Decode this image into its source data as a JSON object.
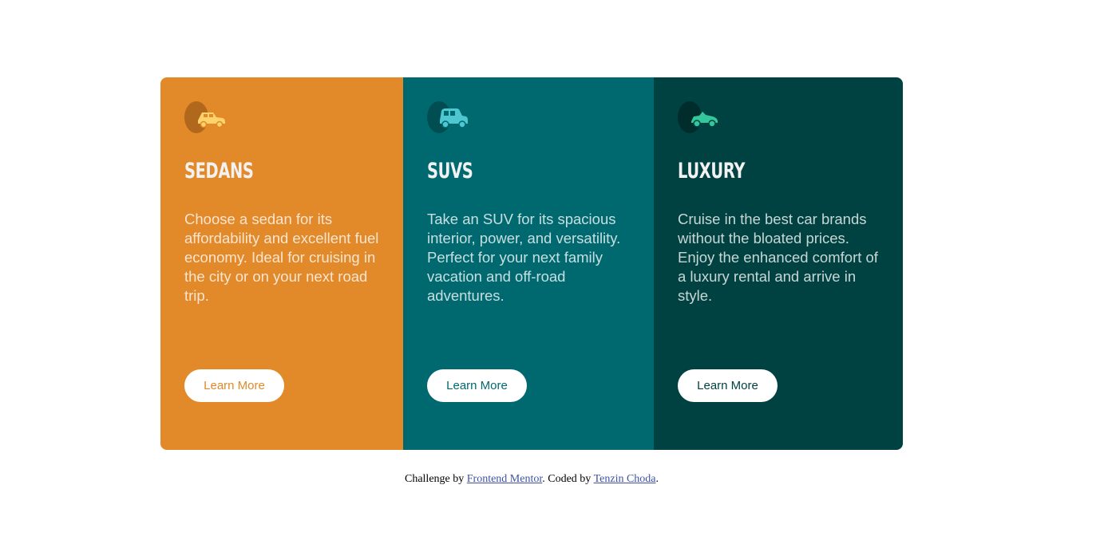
{
  "colors": {
    "sedans": "#e28929",
    "suvs": "#006970",
    "luxury": "#004241",
    "heading_text": "#f2f2f2",
    "link": "#3e52a3"
  },
  "cards": [
    {
      "icon": "sedan-car-icon",
      "title": "Sedans",
      "text": "Choose a sedan for its affordability and excellent fuel economy. Ideal for cruising in the city or on your next road trip.",
      "button_label": "Learn More"
    },
    {
      "icon": "suv-car-icon",
      "title": "SUVs",
      "text": "Take an SUV for its spacious interior, power, and versatility. Perfect for your next family vacation and off-road adventures.",
      "button_label": "Learn More"
    },
    {
      "icon": "luxury-car-icon",
      "title": "Luxury",
      "text": "Cruise in the best car brands without the bloated prices. Enjoy the enhanced comfort of a luxury rental and arrive in style.",
      "button_label": "Learn More"
    }
  ],
  "attribution": {
    "prefix": "Challenge by ",
    "challenge_link": "Frontend Mentor",
    "middle": ". Coded by ",
    "author_link": "Tenzin Choda",
    "suffix": "."
  }
}
